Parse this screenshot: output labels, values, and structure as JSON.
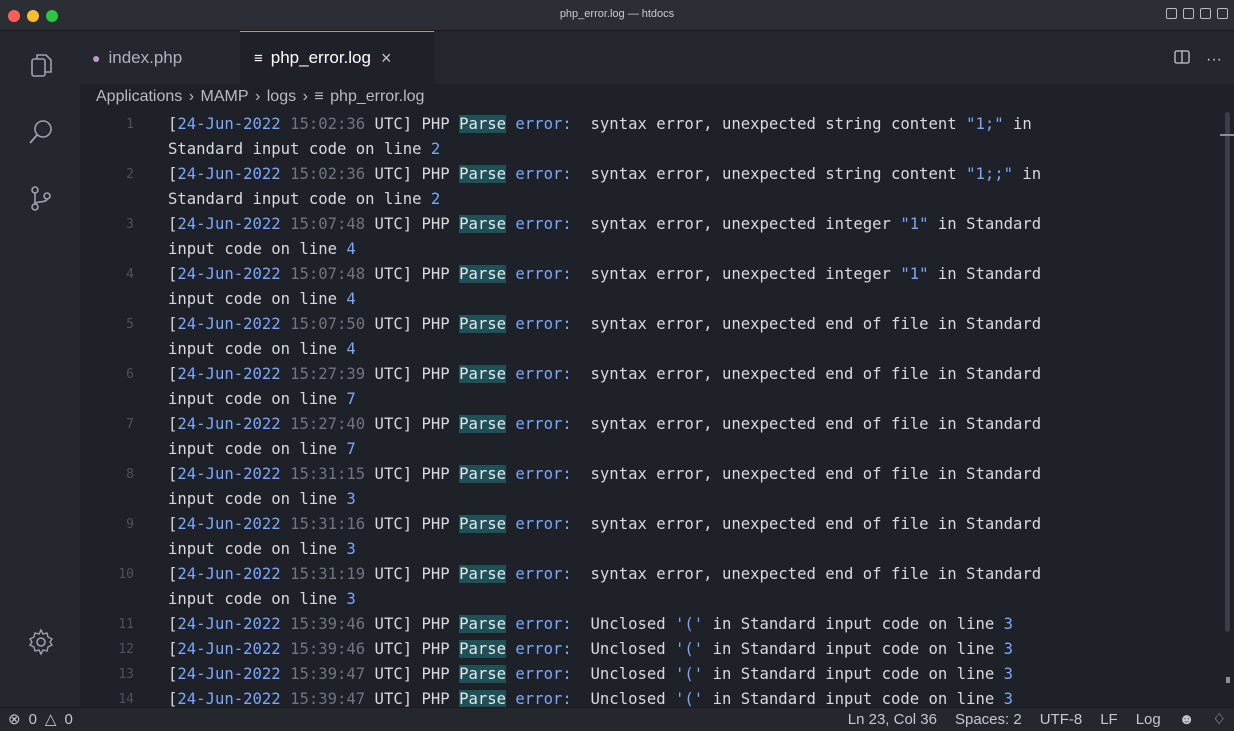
{
  "window": {
    "title": "php_error.log — htdocs"
  },
  "tabs": [
    {
      "label": "index.php",
      "active": false
    },
    {
      "label": "php_error.log",
      "active": true
    }
  ],
  "breadcrumb": [
    "Applications",
    "MAMP",
    "logs",
    "php_error.log"
  ],
  "editor": {
    "lines": [
      {
        "num": "1",
        "date": "24-Jun-",
        "year": "2022",
        "time": "15:02:36",
        "head": " UTC] PHP ",
        "parse": "Parse",
        "err": "error:",
        "msg": "  syntax error, unexpected string content ",
        "str": "\"1;\"",
        "tail": " in",
        "wrap": "Standard input code on line ",
        "wrapnum": "2"
      },
      {
        "num": "2",
        "date": "24-Jun-",
        "year": "2022",
        "time": "15:02:36",
        "head": " UTC] PHP ",
        "parse": "Parse",
        "err": "error:",
        "msg": "  syntax error, unexpected string content ",
        "str": "\"1;;\"",
        "tail": " in",
        "wrap": "Standard input code on line ",
        "wrapnum": "2"
      },
      {
        "num": "3",
        "date": "24-Jun-",
        "year": "2022",
        "time": "15:07:48",
        "head": " UTC] PHP ",
        "parse": "Parse",
        "err": "error:",
        "msg": "  syntax error, unexpected integer ",
        "str": "\"1\"",
        "tail": " in Standard",
        "wrap": "input code on line ",
        "wrapnum": "4"
      },
      {
        "num": "4",
        "date": "24-Jun-",
        "year": "2022",
        "time": "15:07:48",
        "head": " UTC] PHP ",
        "parse": "Parse",
        "err": "error:",
        "msg": "  syntax error, unexpected integer ",
        "str": "\"1\"",
        "tail": " in Standard",
        "wrap": "input code on line ",
        "wrapnum": "4"
      },
      {
        "num": "5",
        "date": "24-Jun-",
        "year": "2022",
        "time": "15:07:50",
        "head": " UTC] PHP ",
        "parse": "Parse",
        "err": "error:",
        "msg": "  syntax error, unexpected end of file in Standard",
        "str": "",
        "tail": "",
        "wrap": "input code on line ",
        "wrapnum": "4"
      },
      {
        "num": "6",
        "date": "24-Jun-",
        "year": "2022",
        "time": "15:27:39",
        "head": " UTC] PHP ",
        "parse": "Parse",
        "err": "error:",
        "msg": "  syntax error, unexpected end of file in Standard",
        "str": "",
        "tail": "",
        "wrap": "input code on line ",
        "wrapnum": "7"
      },
      {
        "num": "7",
        "date": "24-Jun-",
        "year": "2022",
        "time": "15:27:40",
        "head": " UTC] PHP ",
        "parse": "Parse",
        "err": "error:",
        "msg": "  syntax error, unexpected end of file in Standard",
        "str": "",
        "tail": "",
        "wrap": "input code on line ",
        "wrapnum": "7"
      },
      {
        "num": "8",
        "date": "24-Jun-",
        "year": "2022",
        "time": "15:31:15",
        "head": " UTC] PHP ",
        "parse": "Parse",
        "err": "error:",
        "msg": "  syntax error, unexpected end of file in Standard",
        "str": "",
        "tail": "",
        "wrap": "input code on line ",
        "wrapnum": "3"
      },
      {
        "num": "9",
        "date": "24-Jun-",
        "year": "2022",
        "time": "15:31:16",
        "head": " UTC] PHP ",
        "parse": "Parse",
        "err": "error:",
        "msg": "  syntax error, unexpected end of file in Standard",
        "str": "",
        "tail": "",
        "wrap": "input code on line ",
        "wrapnum": "3"
      },
      {
        "num": "10",
        "date": "24-Jun-",
        "year": "2022",
        "time": "15:31:19",
        "head": " UTC] PHP ",
        "parse": "Parse",
        "err": "error:",
        "msg": "  syntax error, unexpected end of file in Standard",
        "str": "",
        "tail": "",
        "wrap": "input code on line ",
        "wrapnum": "3"
      },
      {
        "num": "11",
        "date": "24-Jun-",
        "year": "2022",
        "time": "15:39:46",
        "head": " UTC] PHP ",
        "parse": "Parse",
        "err": "error:",
        "msg": "  Unclosed ",
        "str": "'('",
        "tail": " in Standard input code on line ",
        "tailnum": "3"
      },
      {
        "num": "12",
        "date": "24-Jun-",
        "year": "2022",
        "time": "15:39:46",
        "head": " UTC] PHP ",
        "parse": "Parse",
        "err": "error:",
        "msg": "  Unclosed ",
        "str": "'('",
        "tail": " in Standard input code on line ",
        "tailnum": "3"
      },
      {
        "num": "13",
        "date": "24-Jun-",
        "year": "2022",
        "time": "15:39:47",
        "head": " UTC] PHP ",
        "parse": "Parse",
        "err": "error:",
        "msg": "  Unclosed ",
        "str": "'('",
        "tail": " in Standard input code on line ",
        "tailnum": "3"
      },
      {
        "num": "14",
        "date": "24-Jun-",
        "year": "2022",
        "time": "15:39:47",
        "head": " UTC] PHP ",
        "parse": "Parse",
        "err": "error:",
        "msg": "  Unclosed ",
        "str": "'('",
        "tail": " in Standard input code on line ",
        "tailnum": "3"
      }
    ]
  },
  "statusbar": {
    "errors": "0",
    "warnings": "0",
    "position": "Ln 23, Col 36",
    "spaces": "Spaces: 2",
    "encoding": "UTF-8",
    "eol": "LF",
    "language": "Log"
  },
  "colors": {
    "accent_tab": "#e0913f",
    "highlight": "#1e5158",
    "keyword": "#7aa8ff"
  }
}
